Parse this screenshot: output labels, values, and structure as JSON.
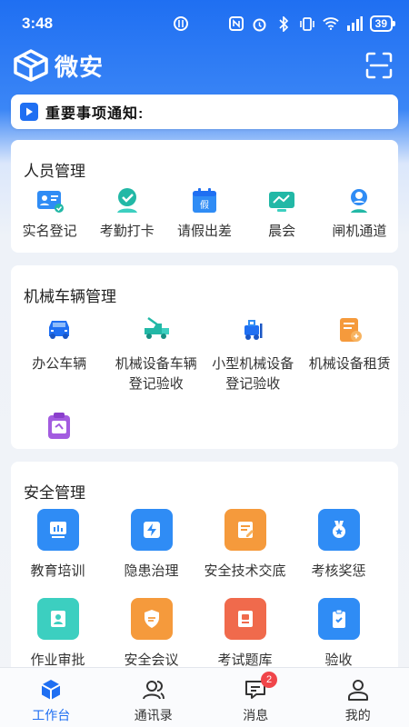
{
  "status_bar": {
    "time": "3:48",
    "battery": "39"
  },
  "header": {
    "app_name": "微安"
  },
  "notice": {
    "text": "重要事项通知:"
  },
  "people": {
    "title": "人员管理",
    "items": [
      {
        "label": "实名登记",
        "icon": "id-card-icon"
      },
      {
        "label": "考勤打卡",
        "icon": "attendance-icon"
      },
      {
        "label": "请假出差",
        "icon": "leave-calendar-icon"
      },
      {
        "label": "晨会",
        "icon": "meeting-icon"
      },
      {
        "label": "闸机通道",
        "icon": "gate-user-icon"
      }
    ]
  },
  "machine": {
    "title": "机械车辆管理",
    "items": [
      {
        "label": "办公车辆",
        "icon": "car-icon"
      },
      {
        "label": "机械设备车辆登记验收",
        "line1": "机械设备车辆",
        "line2": "登记验收",
        "icon": "tow-truck-icon"
      },
      {
        "label": "小型机械设备登记验收",
        "line1": "小型机械设备",
        "line2": "登记验收",
        "icon": "forklift-icon"
      },
      {
        "label": "机械设备租赁",
        "icon": "lease-document-icon"
      },
      {
        "label": "",
        "icon": "clipboard-icon"
      }
    ]
  },
  "safety": {
    "title": "安全管理",
    "items": [
      {
        "label": "教育培训",
        "icon": "training-icon",
        "color": "#2f8cf5"
      },
      {
        "label": "隐患治理",
        "icon": "hazard-icon",
        "color": "#2f8cf5"
      },
      {
        "label": "安全技术交底",
        "icon": "tech-briefing-icon",
        "color": "#f59a3c"
      },
      {
        "label": "考核奖惩",
        "icon": "medal-icon",
        "color": "#2f8cf5"
      },
      {
        "label": "作业审批",
        "icon": "approval-icon",
        "color": "#3ccfc0"
      },
      {
        "label": "安全会议",
        "icon": "shield-icon",
        "color": "#f59a3c"
      },
      {
        "label": "考试题库",
        "icon": "exam-icon",
        "color": "#f06a4c"
      },
      {
        "label": "验收",
        "icon": "acceptance-icon",
        "color": "#2f8cf5"
      }
    ]
  },
  "tabs": [
    {
      "label": "工作台",
      "icon": "workbench-icon",
      "active": true
    },
    {
      "label": "通讯录",
      "icon": "contacts-icon"
    },
    {
      "label": "消息",
      "icon": "message-icon",
      "badge": "2"
    },
    {
      "label": "我的",
      "icon": "profile-icon"
    }
  ],
  "colors": {
    "primary": "#1f6ff2",
    "teal": "#22b8a6",
    "orange": "#f59a3c",
    "badge": "#f0454a"
  }
}
